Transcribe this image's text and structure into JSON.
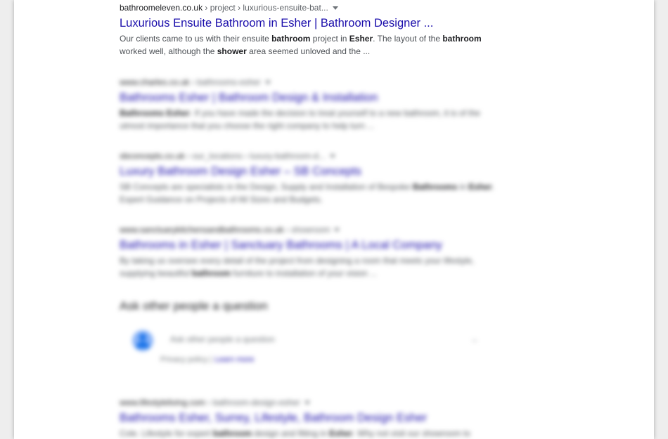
{
  "results": [
    {
      "site": "bathroomeleven.co.uk",
      "path": " › project › luxurious-ensuite-bat...",
      "title": "Luxurious Ensuite Bathroom in Esher | Bathroom Designer ...",
      "snippet_parts": [
        {
          "t": "Our clients came to us with their ensuite ",
          "b": false
        },
        {
          "t": "bathroom",
          "b": true
        },
        {
          "t": " project in ",
          "b": false
        },
        {
          "t": "Esher",
          "b": true
        },
        {
          "t": ". The layout of the ",
          "b": false
        },
        {
          "t": "bathroom",
          "b": true
        },
        {
          "t": " worked well, although the ",
          "b": false
        },
        {
          "t": "shower",
          "b": true
        },
        {
          "t": " area seemed unloved and the ...",
          "b": false
        }
      ]
    },
    {
      "site": "www.charles.co.uk",
      "path": " › bathrooms-esher",
      "title": "Bathrooms Esher | Bathroom Design & Installation",
      "snippet_parts": [
        {
          "t": "Bathrooms Esher",
          "b": true
        },
        {
          "t": ". If you have made the decision to treat yourself to a new bathroom, it is of the utmost importance that you choose the right company to help turn ...",
          "b": false
        }
      ]
    },
    {
      "site": "sbconcepts.co.uk",
      "path": " › our_locations › luxury-bathroom-d...",
      "title": "Luxury Bathroom Design Esher – SB Concepts",
      "snippet_parts": [
        {
          "t": "SB Concepts are specialists in the Design, Supply and Installation of Bespoke ",
          "b": false
        },
        {
          "t": "Bathrooms",
          "b": true
        },
        {
          "t": " in ",
          "b": false
        },
        {
          "t": "Esher",
          "b": true
        },
        {
          "t": ". Expert Guidance on Projects of All Sizes and Budgets.",
          "b": false
        }
      ]
    },
    {
      "site": "www.sanctuarykitchensandbathrooms.co.uk",
      "path": " › showroom",
      "title": "Bathrooms in Esher | Sanctuary Bathrooms | A Local Company",
      "snippet_parts": [
        {
          "t": "By taking us oversee every detail of the project from designing a room that meets your lifestyle, supplying beautiful ",
          "b": false
        },
        {
          "t": "bathroom",
          "b": true
        },
        {
          "t": " furniture to installation of your vision ...",
          "b": false
        }
      ]
    }
  ],
  "paa": {
    "heading": "Ask other people a question",
    "prompt": "Ask other people a question",
    "arrow": "→",
    "footer_text": "Privacy policy |",
    "footer_link": "Learn more"
  },
  "last_result": {
    "site": "www.lifestyleliving.com",
    "path": " › bathroom-design-esher",
    "title": "Bathrooms Esher, Surrey, Lifestyle, Bathroom Design Esher",
    "snippet_parts": [
      {
        "t": "Cole. Lifestyle for expert ",
        "b": false
      },
      {
        "t": "bathroom",
        "b": true
      },
      {
        "t": " design and fitting in ",
        "b": false
      },
      {
        "t": "Esher",
        "b": true
      },
      {
        "t": ". Why not visit our showroom to",
        "b": false
      }
    ]
  },
  "colors": {
    "link": "#1a0dab",
    "text": "#4d5156",
    "crumb": "#202124"
  }
}
